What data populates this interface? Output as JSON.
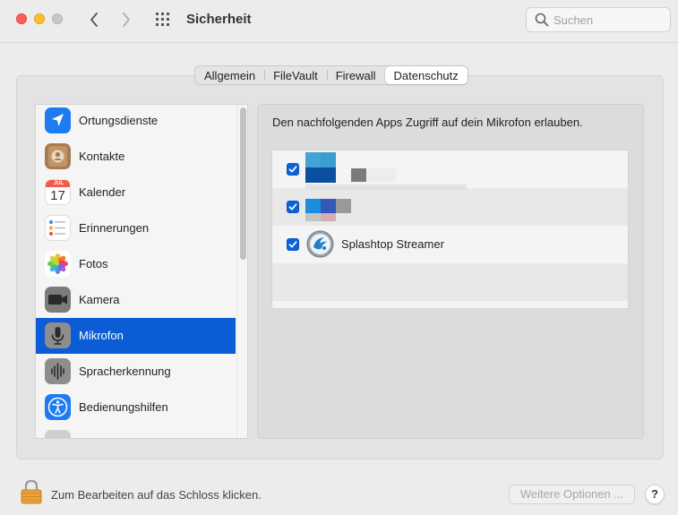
{
  "window": {
    "title": "Sicherheit",
    "search_placeholder": "Suchen"
  },
  "tabs": [
    {
      "label": "Allgemein",
      "active": false
    },
    {
      "label": "FileVault",
      "active": false
    },
    {
      "label": "Firewall",
      "active": false
    },
    {
      "label": "Datenschutz",
      "active": true
    }
  ],
  "sidebar": {
    "items": [
      {
        "label": "Ortungsdienste",
        "icon": "location-arrow-icon"
      },
      {
        "label": "Kontakte",
        "icon": "contacts-icon"
      },
      {
        "label": "Kalender",
        "icon": "calendar-icon",
        "month": "JUL",
        "day": "17"
      },
      {
        "label": "Erinnerungen",
        "icon": "reminders-icon"
      },
      {
        "label": "Fotos",
        "icon": "photos-icon"
      },
      {
        "label": "Kamera",
        "icon": "camera-icon"
      },
      {
        "label": "Mikrofon",
        "icon": "microphone-icon",
        "selected": true
      },
      {
        "label": "Spracherkennung",
        "icon": "waveform-icon"
      },
      {
        "label": "Bedienungshilfen",
        "icon": "accessibility-icon"
      }
    ]
  },
  "content": {
    "description": "Den nachfolgenden Apps Zugriff auf dein Mikrofon erlauben.",
    "apps": [
      {
        "name": "",
        "checked": true,
        "blurred": true
      },
      {
        "name": "",
        "checked": true,
        "blurred": true
      },
      {
        "name": "Splashtop Streamer",
        "checked": true,
        "blurred": false
      }
    ]
  },
  "footer": {
    "lock_text": "Zum Bearbeiten auf das Schloss klicken.",
    "advanced_button": "Weitere Optionen ...",
    "help_button": "?"
  },
  "colors": {
    "selection": "#0b5cd5",
    "checkbox": "#0b62d9"
  }
}
